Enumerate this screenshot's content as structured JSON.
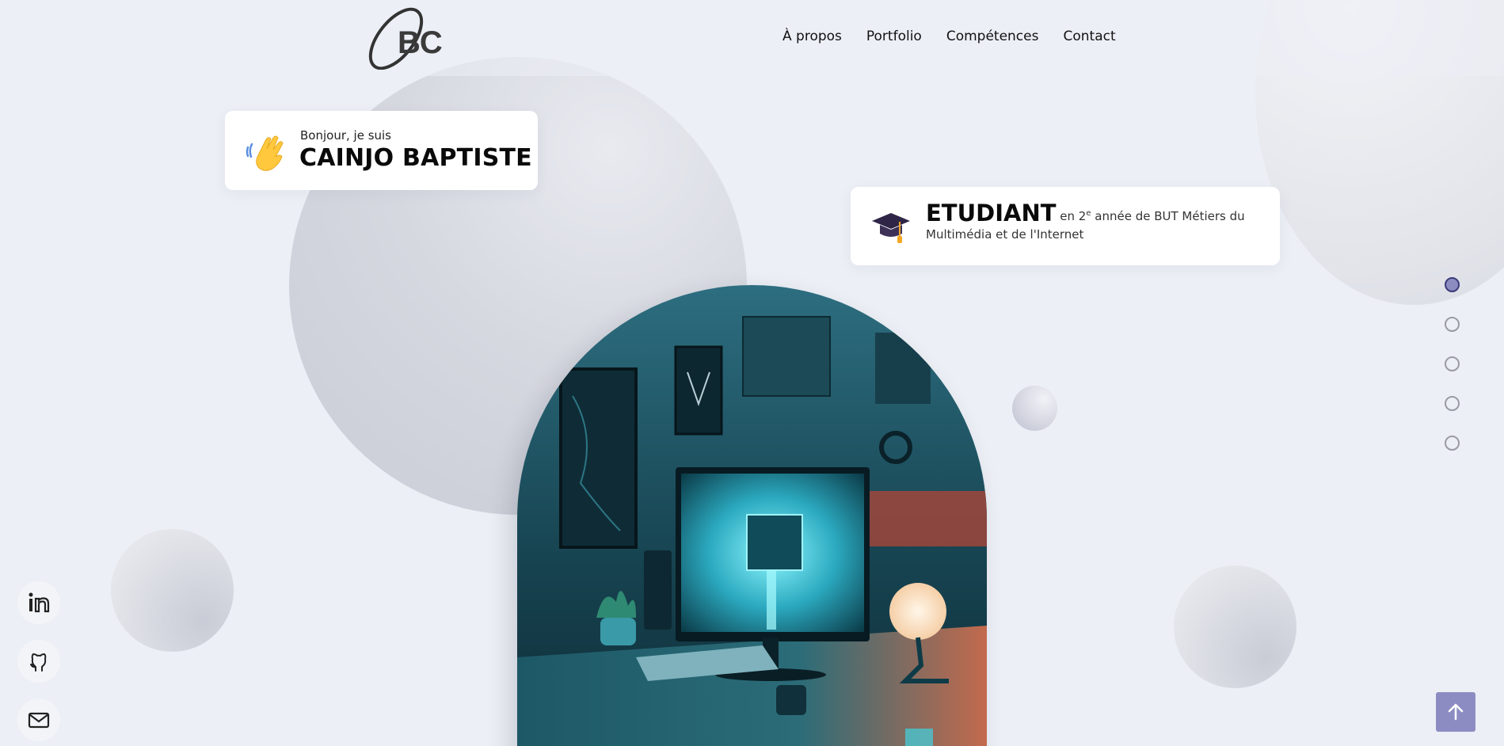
{
  "brand": {
    "logo_text": "BC"
  },
  "nav": {
    "items": [
      "À propos",
      "Portfolio",
      "Compétences",
      "Contact"
    ]
  },
  "hero": {
    "greeting": "Bonjour, je suis",
    "name": "CAINJO BAPTISTE",
    "role": "ETUDIANT",
    "role_desc_pre": "en 2",
    "role_desc_sup": "e",
    "role_desc_post": "année de BUT Métiers du Multimédia et de l'Internet"
  },
  "section_dots": {
    "count": 5,
    "active": 0
  },
  "social": [
    "linkedin-icon",
    "github-icon",
    "mail-icon"
  ],
  "colors": {
    "background": "#eceff5",
    "accent": "#8d8cc2",
    "card": "#ffffff"
  }
}
